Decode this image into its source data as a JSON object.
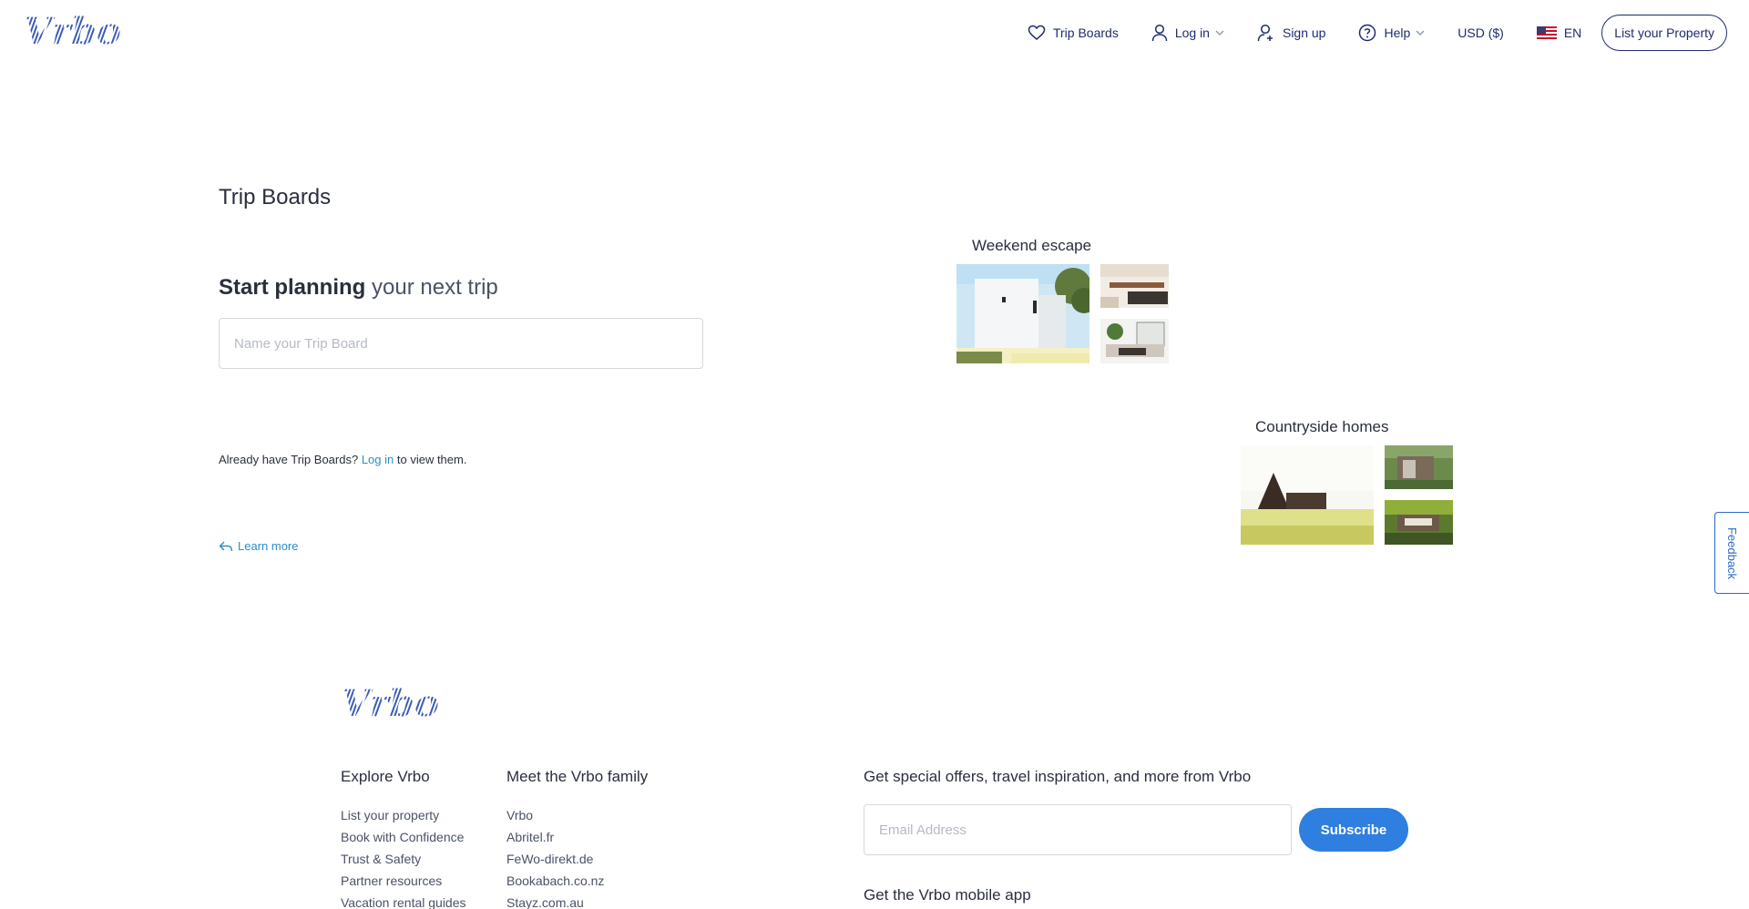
{
  "brand": {
    "logo_text": "Vrbo",
    "accent": "#2f7fe0",
    "link": "#2b8fc8",
    "nav_color": "#1f2b6f"
  },
  "header": {
    "nav": {
      "trip_boards": "Trip Boards",
      "log_in": "Log in",
      "sign_up": "Sign up",
      "help": "Help",
      "currency": "USD ($)",
      "language": "EN",
      "list_property": "List your Property"
    }
  },
  "main": {
    "page_title": "Trip Boards",
    "plan_bold": "Start planning",
    "plan_light": "your next trip",
    "board_name_placeholder": "Name your Trip Board",
    "already_prefix": "Already have Trip Boards?",
    "already_link": "Log in",
    "already_suffix": "to view them.",
    "learn_more": "Learn more"
  },
  "boards": [
    {
      "title": "Weekend escape"
    },
    {
      "title": "Countryside homes"
    }
  ],
  "feedback_label": "Feedback",
  "footer": {
    "explore": {
      "title": "Explore Vrbo",
      "links": [
        "List your property",
        "Book with Confidence",
        "Trust & Safety",
        "Partner resources",
        "Vacation rental guides"
      ]
    },
    "family": {
      "title": "Meet the Vrbo family",
      "links": [
        "Vrbo",
        "Abritel.fr",
        "FeWo-direkt.de",
        "Bookabach.co.nz",
        "Stayz.com.au"
      ]
    },
    "newsletter": {
      "title": "Get special offers, travel inspiration, and more from Vrbo",
      "email_placeholder": "Email Address",
      "subscribe": "Subscribe"
    },
    "app_title": "Get the Vrbo mobile app"
  }
}
